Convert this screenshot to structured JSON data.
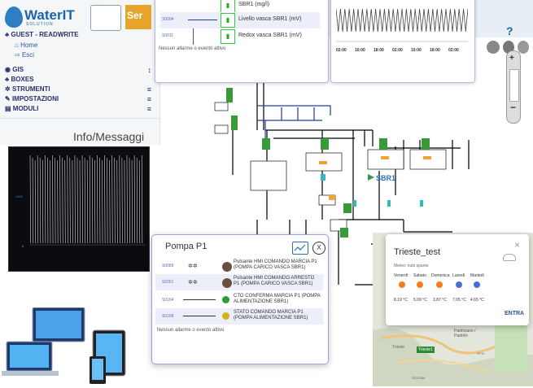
{
  "logo": {
    "text": "WaterIT",
    "sub": "SOLUTION",
    "partner": "Ser"
  },
  "sidebar": {
    "user": "GUEST - READWRITE",
    "home": "Home",
    "exit": "Esci",
    "menu": [
      {
        "label": "GIS",
        "ham": ""
      },
      {
        "label": "BOXES",
        "ham": ""
      },
      {
        "label": "STRUMENTI",
        "ham": "≡"
      },
      {
        "label": "IMPOSTAZIONI",
        "ham": "≡"
      },
      {
        "label": "MODULI",
        "ham": "≡"
      }
    ],
    "info_title": "Info/Messaggi"
  },
  "left_panel": {
    "rows": [
      {
        "id": "",
        "label": "SBR1 (mg/l)"
      },
      {
        "id": "S0004",
        "label": "Livello vasca SBR1 (mV)"
      },
      {
        "id": "S0011",
        "label": "Redox vasca SBR1 (mV)"
      }
    ],
    "footer": "Nessun allarme o evento attivo"
  },
  "right_panel": {
    "times": [
      "02:00",
      "10:00",
      "18:00",
      "02:00",
      "10:00",
      "18:00",
      "02:00"
    ]
  },
  "scada": {
    "tank_label": "SBR1",
    "play_icon": "play-icon"
  },
  "help_label": "?",
  "pompa": {
    "title": "Pompa P1",
    "rows": [
      {
        "id": "S0089",
        "label": "Pulsante HMI COMANDO MARCIA P1 (POMPA CARICO VASCA SBR1)",
        "led": "#6b4e3f"
      },
      {
        "id": "S0261",
        "label": "Pulsante HMI COMANDO ARRESTO P1 (POMPA CARICO VASCA SBR1)",
        "led": "#6b4e3f"
      },
      {
        "id": "S0164",
        "label": "CTO CONFERMA MARCIA P1 (POMPA ALIMENTAZIONE SBR1)",
        "led": "#27a032"
      },
      {
        "id": "S0168",
        "label": "STATO COMANDO MARCIA P1 (POMPA ALIMENTAZIONE SBR1)",
        "led": "#d4b21b"
      }
    ],
    "footer": "Nessun allarme o evento attivo",
    "close": "X"
  },
  "weather": {
    "title": "Trieste_test",
    "subtitle": "Meteo: nubi sparse",
    "days": [
      "Venerdì",
      "Sabato",
      "Domenica",
      "Lunedì",
      "Martedì"
    ],
    "temps": [
      "8.19 °C",
      "5.09 °C",
      "3.87 °C",
      "7.05 °C",
      "4.65 °C"
    ],
    "button": "ENTRA",
    "close": "×"
  },
  "map": {
    "labels": [
      "Trieste1",
      "Padriciano / Padriče",
      "SP11",
      "SS202dir",
      "Trieste"
    ]
  },
  "dark_chart": {
    "axis_label": "1000",
    "y0": "0"
  }
}
